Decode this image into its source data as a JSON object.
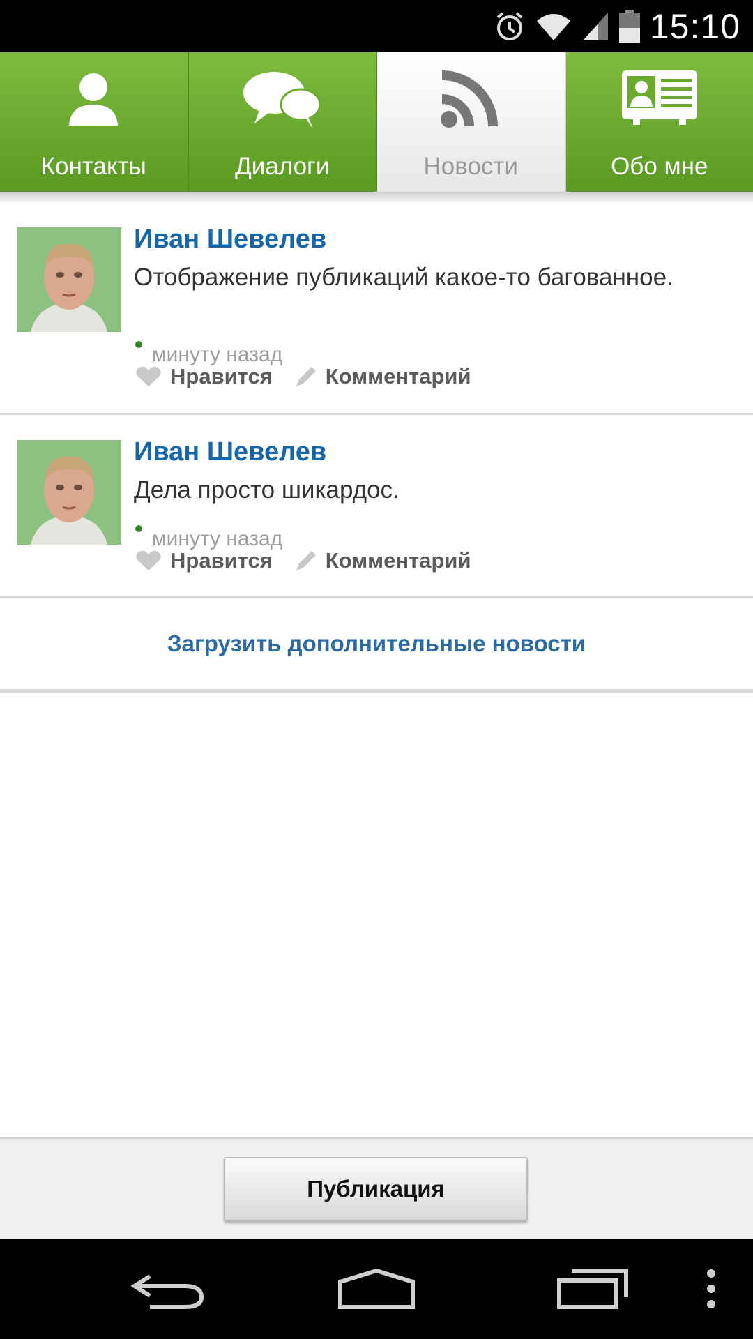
{
  "status_bar": {
    "time": "15:10",
    "icons": [
      "alarm-icon",
      "wifi-icon",
      "signal-icon",
      "battery-icon"
    ]
  },
  "tabs": [
    {
      "label": "Контакты",
      "icon": "contact-icon",
      "active": false
    },
    {
      "label": "Диалоги",
      "icon": "chat-bubbles-icon",
      "active": false
    },
    {
      "label": "Новости",
      "icon": "rss-feed-icon",
      "active": true
    },
    {
      "label": "Обо мне",
      "icon": "profile-card-icon",
      "active": false
    }
  ],
  "posts": [
    {
      "author": "Иван Шевелев",
      "text": "Отображение публикаций какое-то багованное.",
      "time": "минуту назад",
      "like_label": "Нравится",
      "comment_label": "Комментарий"
    },
    {
      "author": "Иван Шевелев",
      "text": "Дела просто шикардос.",
      "time": "минуту назад",
      "like_label": "Нравится",
      "comment_label": "Комментарий"
    }
  ],
  "load_more_label": "Загрузить дополнительные новости",
  "publish_button_label": "Публикация",
  "colors": {
    "accent_green": "#6aaa2e",
    "link_blue": "#1767a8"
  }
}
